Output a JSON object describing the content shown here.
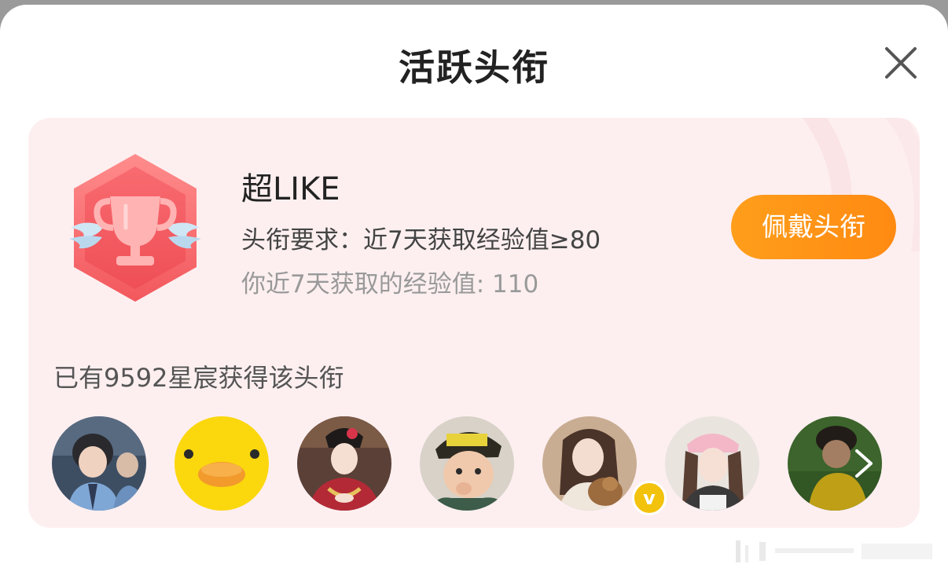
{
  "modal": {
    "title": "活跃头衔"
  },
  "badge_card": {
    "name": "超LIKE",
    "requirement": "头衔要求：近7天获取经验值≥80",
    "your_experience": "你近7天获取的经验值: 110",
    "wear_button_label": "佩戴头衔",
    "accent_color": "#ff9614",
    "card_color": "#fdeff0"
  },
  "owners": {
    "count_text": "已有9592星宸获得该头衔",
    "avatars": [
      {
        "name": "avatar-1",
        "verified": false
      },
      {
        "name": "avatar-2",
        "verified": false
      },
      {
        "name": "avatar-3",
        "verified": false
      },
      {
        "name": "avatar-4",
        "verified": false
      },
      {
        "name": "avatar-5",
        "verified": true,
        "verified_mark": "v"
      },
      {
        "name": "avatar-6",
        "verified": false
      },
      {
        "name": "avatar-7",
        "verified": false
      }
    ],
    "more_icon": "chevron-right-icon"
  },
  "icons": {
    "close": "close-icon",
    "badge": "trophy-badge-icon"
  }
}
